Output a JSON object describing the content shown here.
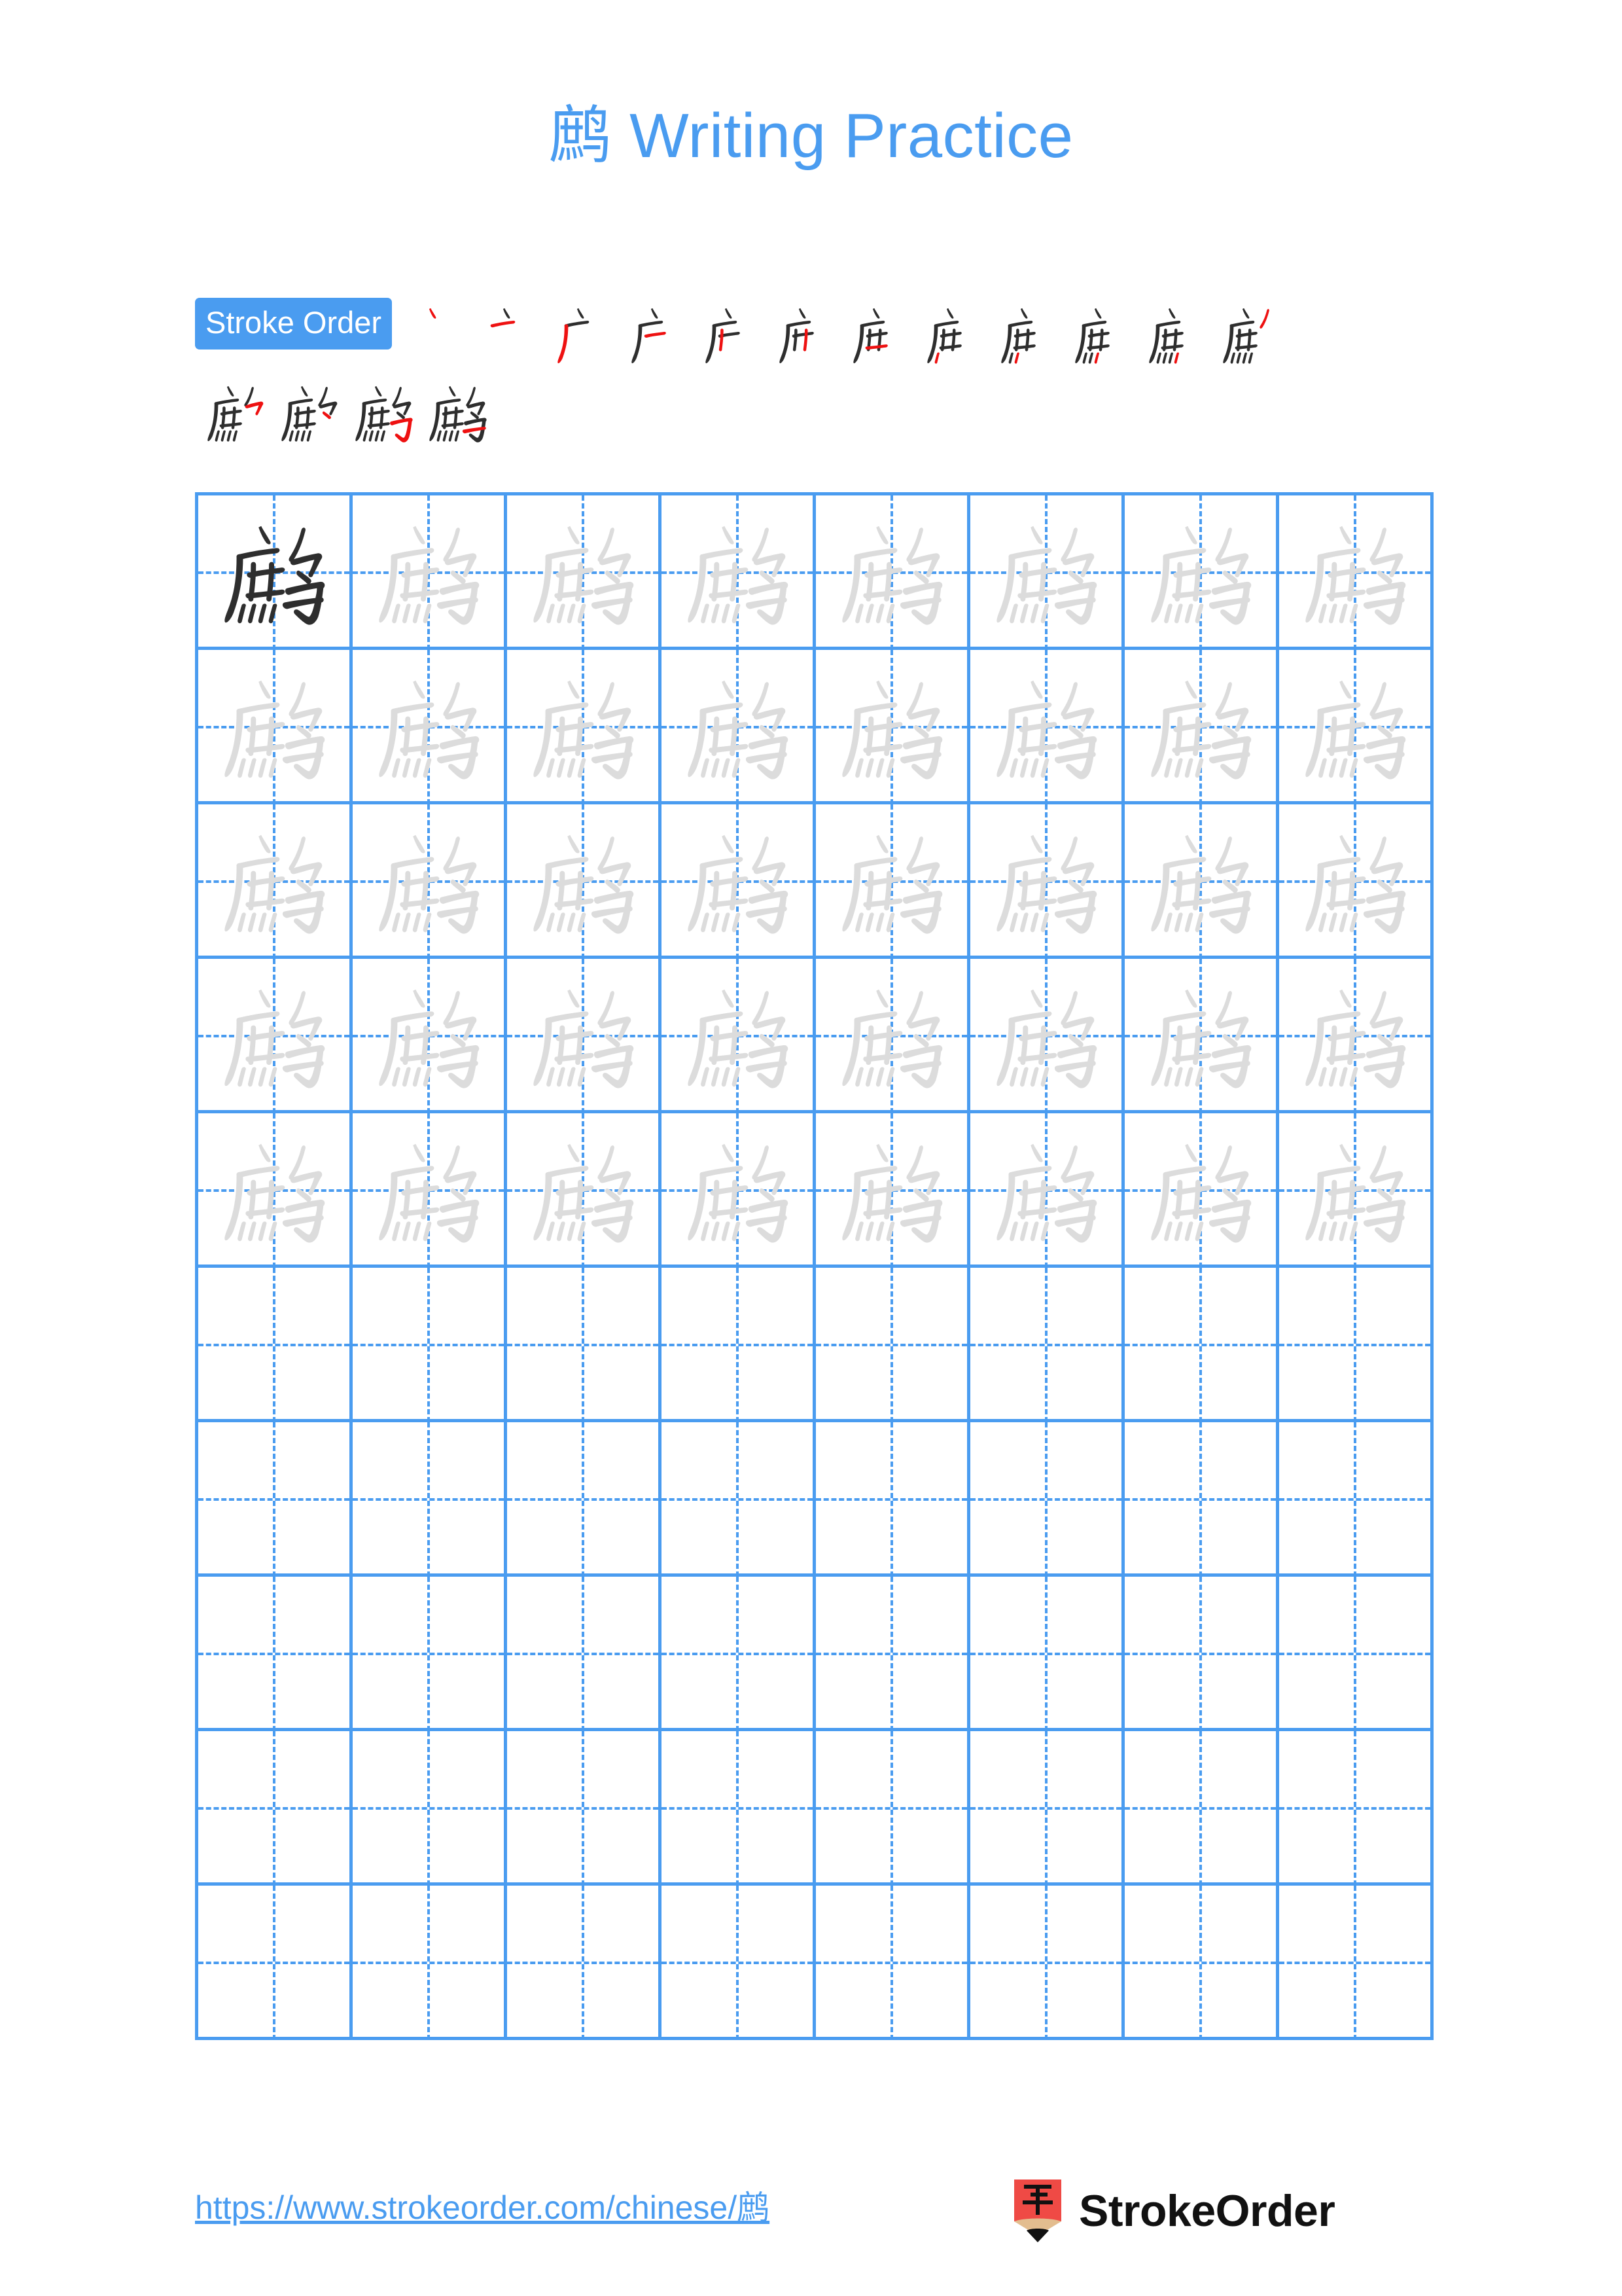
{
  "character": "鹧",
  "title": {
    "char": "鹧",
    "suffix": " Writing Practice",
    "full": "鹧 Writing Practice",
    "color": "#4a9cf0"
  },
  "stroke_order": {
    "badge_label": "Stroke Order",
    "badge_bg": "#4a9cf0",
    "badge_text_color": "#ffffff",
    "total_strokes": 16,
    "new_stroke_color": "#ee1111",
    "existing_stroke_color": "#2e2e2e",
    "steps": [
      {
        "index": 1,
        "partial": "丶"
      },
      {
        "index": 2,
        "partial": "亠"
      },
      {
        "index": 3,
        "partial": "广"
      },
      {
        "index": 4,
        "partial": "广"
      },
      {
        "index": 5,
        "partial": "庄"
      },
      {
        "index": 6,
        "partial": "庄"
      },
      {
        "index": 7,
        "partial": "庐"
      },
      {
        "index": 8,
        "partial": "庶"
      },
      {
        "index": 9,
        "partial": "庶"
      },
      {
        "index": 10,
        "partial": "庶"
      },
      {
        "index": 11,
        "partial": "庶"
      },
      {
        "index": 12,
        "partial": "庶"
      },
      {
        "index": 13,
        "partial": "庶"
      },
      {
        "index": 14,
        "partial": "庶"
      },
      {
        "index": 15,
        "partial": "鹧"
      },
      {
        "index": 16,
        "partial": "鹧"
      }
    ]
  },
  "grid": {
    "columns": 8,
    "rows": 10,
    "line_color": "#4a9cf0",
    "guide_color": "#4a9cf0",
    "model_char_color": "#2e2e2e",
    "trace_char_color": "#dcdcdc",
    "row_types": [
      "model-first-then-trace",
      "trace",
      "trace",
      "trace",
      "trace",
      "empty",
      "empty",
      "empty",
      "empty",
      "empty"
    ]
  },
  "footer": {
    "url": "https://www.strokeorder.com/chinese/鹧",
    "url_color": "#4a9cf0",
    "logo_text": "StrokeOrder",
    "logo_char": "字",
    "logo_body_color": "#ef4a45",
    "logo_tip_color": "#e3bd8f",
    "logo_point_color": "#111111"
  }
}
